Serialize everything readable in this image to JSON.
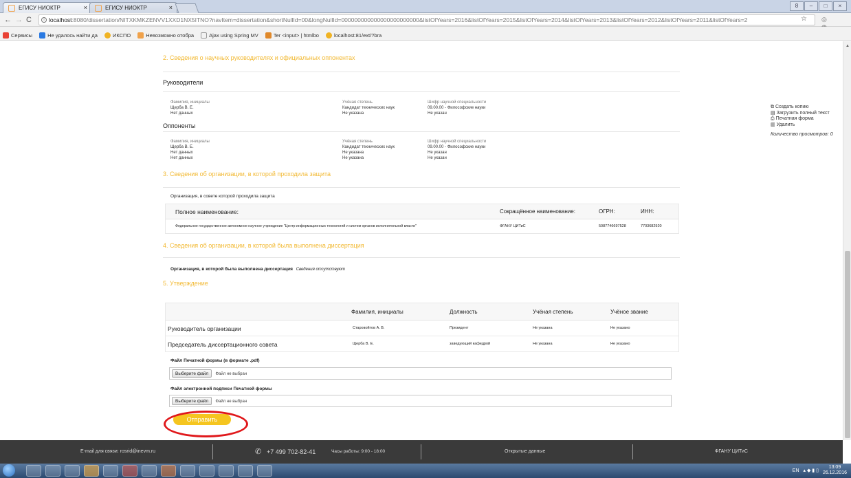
{
  "browser": {
    "tabs": [
      {
        "title": "ЕГИСУ НИОКТР"
      },
      {
        "title": "ЕГИСУ НИОКТР"
      }
    ],
    "url": {
      "host": "localhost",
      "rest": ":8080/dissertation/NITXKMKZENVV1XXD1NX5ITNO?navItem=dissertation&shortNullId=00&longNullId=000000000000000000000000&listOfYears=2016&listOfYears=2015&listOfYears=2014&listOfYears=2013&listOfYears=2012&listOfYears=2011&listOfYears=2"
    },
    "bookmarks": [
      {
        "label": "Сервисы",
        "color": "#e94235"
      },
      {
        "label": "Не удалось найти да",
        "color": "#2a7ae2"
      },
      {
        "label": "ИКСПО",
        "color": "#f0b323"
      },
      {
        "label": "Невозможно отобра",
        "color": "#f0a24b"
      },
      {
        "label": "Ajax using Spring MV",
        "color": "#999999"
      },
      {
        "label": "Ter <input> | htmlbo",
        "color": "#e0892b"
      },
      {
        "label": "localhost:81/ext/?bra",
        "color": "#f0b323"
      }
    ]
  },
  "sections": {
    "s2": "2. Сведения о научных руководителях и официальных оппонентах",
    "s3": "3. Сведения об организации, в которой проходила защита",
    "s4": "4. Сведения об организации, в которой была выполнена диссертация",
    "s5": "5. Утверждение"
  },
  "supervisors": {
    "title": "Руководители",
    "col_names": "Фамилия, инициалы",
    "col_degree": "Учёная степень",
    "col_code": "Шифр научной специальности",
    "rows": [
      {
        "name": "Щерба В. Е.",
        "degree": "Кандидат технических наук",
        "code": "09.00.00 - Философские науки"
      },
      {
        "name": "Нет данных",
        "degree": "Не указана",
        "code": "Не указан"
      }
    ]
  },
  "opponents": {
    "title": "Оппоненты",
    "col_names": "Фамилия, инициалы",
    "col_degree": "Учёная степень",
    "col_code": "Шифр научной специальности",
    "rows": [
      {
        "name": "Щерба В. Е.",
        "degree": "Кандидат технических наук",
        "code": "09.00.00 - Философские науки"
      },
      {
        "name": "Нет данных",
        "degree": "Не указана",
        "code": "Не указан"
      },
      {
        "name": "Нет данных",
        "degree": "Не указана",
        "code": "Не указан"
      }
    ]
  },
  "defense_org": {
    "caption": "Организация, в совете которой проходила защита",
    "headers": {
      "full": "Полное наименование:",
      "short": "Сокращённое наименование:",
      "ogrn": "ОГРН:",
      "inn": "ИНН:"
    },
    "row": {
      "full": "Федеральное государственное автономное научное учреждение \"Центр информационных технологий и систем органов исполнительной власти\"",
      "short": "ФГАНУ ЦИТиС",
      "ogrn": "5087746697528",
      "inn": "7703682920"
    }
  },
  "work_org": {
    "label": "Организация, в которой была выполнена диссертация",
    "value": "Сведения отсутствуют"
  },
  "approval": {
    "headers": {
      "name": "Фамилия, инициалы",
      "position": "Должность",
      "degree": "Учёная степень",
      "title": "Учёное звание"
    },
    "rows": [
      {
        "role": "Руководитель организации",
        "name": "Старовойтов А. В.",
        "position": "Президент",
        "degree": "Не указана",
        "title": "Не указано"
      },
      {
        "role": "Председатель диссертационного совета",
        "name": "Щерба В. Е.",
        "position": "заведующий кафедрой",
        "degree": "Не указана",
        "title": "Не указано"
      }
    ]
  },
  "files": {
    "print_label": "Файл Печатной формы (в формате .pdf)",
    "sign_label": "Файл электронной подписи Печатной формы",
    "button": "Выберите файл",
    "status": "Файл не выбран"
  },
  "submit_label": "Отправить",
  "sidebar": {
    "copy": "Создать копию",
    "upload": "Загрузить полный текст",
    "print": "Печатная форма",
    "delete": "Удалить",
    "views": "Количество просмотров: 0"
  },
  "footer": {
    "email": "E-mail для связи: rosrid@inevm.ru",
    "phone": "+7 499 702-82-41",
    "hours": "Часы работы: 9:00 - 18:00",
    "open_data": "Открытые данные",
    "org": "ФГАНУ ЦИТиС"
  },
  "tray": {
    "lang": "EN",
    "time": "13:09",
    "date": "26.12.2016"
  }
}
